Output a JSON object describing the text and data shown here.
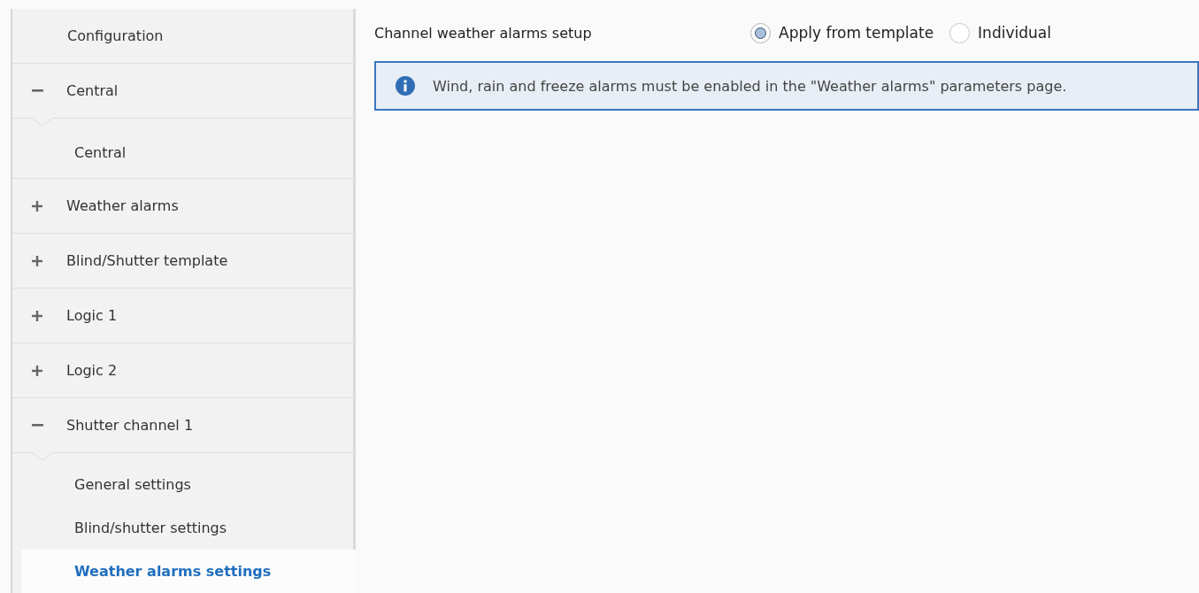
{
  "sidebar": {
    "items": [
      {
        "kind": "plain",
        "label": "Configuration"
      },
      {
        "kind": "group",
        "label": "Central",
        "expanded": true,
        "children": [
          {
            "label": "Central",
            "selected": false
          }
        ]
      },
      {
        "kind": "group",
        "label": "Weather alarms",
        "expanded": false
      },
      {
        "kind": "group",
        "label": "Blind/Shutter template",
        "expanded": false
      },
      {
        "kind": "group",
        "label": "Logic 1",
        "expanded": false
      },
      {
        "kind": "group",
        "label": "Logic 2",
        "expanded": false
      },
      {
        "kind": "group",
        "label": "Shutter channel 1",
        "expanded": true,
        "children": [
          {
            "label": "General settings",
            "selected": false
          },
          {
            "label": "Blind/shutter settings",
            "selected": false
          },
          {
            "label": "Weather alarms settings",
            "selected": true
          }
        ]
      }
    ]
  },
  "setting": {
    "label": "Channel weather alarms setup",
    "options": [
      {
        "label": "Apply from template",
        "selected": true
      },
      {
        "label": "Individual",
        "selected": false
      }
    ]
  },
  "info": {
    "text": "Wind, rain and freeze alarms must be enabled in the \"Weather alarms\" parameters page."
  }
}
